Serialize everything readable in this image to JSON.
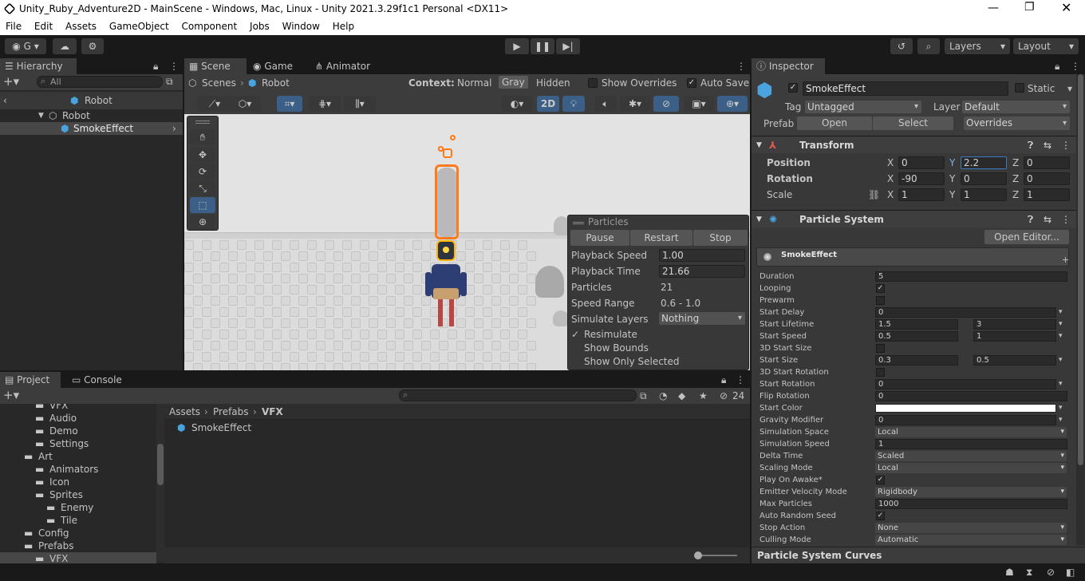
{
  "window": {
    "title": "Unity_Ruby_Adventure2D - MainScene - Windows, Mac, Linux - Unity 2021.3.29f1c1 Personal <DX11>"
  },
  "menu": [
    "File",
    "Edit",
    "Assets",
    "GameObject",
    "Component",
    "Jobs",
    "Window",
    "Help"
  ],
  "toolbar": {
    "account_label": "G",
    "layers_label": "Layers",
    "layout_label": "Layout"
  },
  "hierarchy": {
    "tab": "Hierarchy",
    "search_placeholder": "All",
    "root": "Robot",
    "items": [
      "Robot",
      "SmokeEffect"
    ]
  },
  "scene": {
    "tabs": [
      "Scene",
      "Game",
      "Animator"
    ],
    "breadcrumb": [
      "Scenes",
      "Robot"
    ],
    "context_label": "Context:",
    "context_options": [
      "Normal",
      "Gray",
      "Hidden"
    ],
    "context_selected": "Gray",
    "show_overrides": "Show Overrides",
    "auto_save": "Auto Save",
    "btn_2d": "2D"
  },
  "particles_overlay": {
    "title": "Particles",
    "buttons": [
      "Pause",
      "Restart",
      "Stop"
    ],
    "rows": [
      {
        "label": "Playback Speed",
        "value": "1.00"
      },
      {
        "label": "Playback Time",
        "value": "21.66"
      },
      {
        "label": "Particles",
        "value": "21"
      },
      {
        "label": "Speed Range",
        "value": "0.6 - 1.0"
      }
    ],
    "simulate_layers_label": "Simulate Layers",
    "simulate_layers_value": "Nothing",
    "checks": [
      {
        "label": "Resimulate",
        "checked": true
      },
      {
        "label": "Show Bounds",
        "checked": false
      },
      {
        "label": "Show Only Selected",
        "checked": false
      }
    ]
  },
  "project": {
    "tabs": [
      "Project",
      "Console"
    ],
    "hidden_count": "24",
    "tree": [
      {
        "label": "VFX",
        "indent": 2
      },
      {
        "label": "Audio",
        "indent": 2
      },
      {
        "label": "Demo",
        "indent": 2
      },
      {
        "label": "Settings",
        "indent": 2
      },
      {
        "label": "Art",
        "indent": 1
      },
      {
        "label": "Animators",
        "indent": 2
      },
      {
        "label": "Icon",
        "indent": 2
      },
      {
        "label": "Sprites",
        "indent": 2
      },
      {
        "label": "Enemy",
        "indent": 3
      },
      {
        "label": "Tile",
        "indent": 3
      },
      {
        "label": "Config",
        "indent": 1
      },
      {
        "label": "Prefabs",
        "indent": 1
      },
      {
        "label": "VFX",
        "indent": 2
      }
    ],
    "breadcrumb": [
      "Assets",
      "Prefabs",
      "VFX"
    ],
    "asset": "SmokeEffect"
  },
  "inspector": {
    "tab": "Inspector",
    "object_name": "SmokeEffect",
    "static_label": "Static",
    "tag_label": "Tag",
    "tag_value": "Untagged",
    "layer_label": "Layer",
    "layer_value": "Default",
    "prefab_label": "Prefab",
    "prefab_open": "Open",
    "prefab_select": "Select",
    "prefab_overrides": "Overrides",
    "transform": {
      "title": "Transform",
      "position_label": "Position",
      "position": {
        "x": "0",
        "y": "2.2",
        "z": "0"
      },
      "rotation_label": "Rotation",
      "rotation": {
        "x": "-90",
        "y": "0",
        "z": "0"
      },
      "scale_label": "Scale",
      "scale": {
        "x": "1",
        "y": "1",
        "z": "1"
      }
    },
    "particle_system": {
      "title": "Particle System",
      "open_editor": "Open Editor...",
      "module_name": "SmokeEffect",
      "rows": [
        {
          "label": "Duration",
          "kind": "field",
          "value": "5"
        },
        {
          "label": "Looping",
          "kind": "check",
          "checked": true
        },
        {
          "label": "Prewarm",
          "kind": "check",
          "checked": false
        },
        {
          "label": "Start Delay",
          "kind": "field",
          "value": "0",
          "caret": true
        },
        {
          "label": "Start Lifetime",
          "kind": "pair",
          "value": "1.5",
          "value2": "3",
          "caret": true
        },
        {
          "label": "Start Speed",
          "kind": "pair",
          "value": "0.5",
          "value2": "1",
          "caret": true
        },
        {
          "label": "3D Start Size",
          "kind": "check",
          "checked": false
        },
        {
          "label": "Start Size",
          "kind": "pair",
          "value": "0.3",
          "value2": "0.5",
          "caret": true
        },
        {
          "label": "3D Start Rotation",
          "kind": "check",
          "checked": false
        },
        {
          "label": "Start Rotation",
          "kind": "field",
          "value": "0",
          "caret": true
        },
        {
          "label": "Flip Rotation",
          "kind": "field",
          "value": "0"
        },
        {
          "label": "Start Color",
          "kind": "color",
          "value": "#ffffff",
          "caret": true
        },
        {
          "label": "Gravity Modifier",
          "kind": "field",
          "value": "0",
          "caret": true
        },
        {
          "label": "Simulation Space",
          "kind": "dropdown",
          "value": "Local"
        },
        {
          "label": "Simulation Speed",
          "kind": "field",
          "value": "1"
        },
        {
          "label": "Delta Time",
          "kind": "dropdown",
          "value": "Scaled"
        },
        {
          "label": "Scaling Mode",
          "kind": "dropdown",
          "value": "Local"
        },
        {
          "label": "Play On Awake*",
          "kind": "check",
          "checked": true
        },
        {
          "label": "Emitter Velocity Mode",
          "kind": "dropdown",
          "value": "Rigidbody"
        },
        {
          "label": "Max Particles",
          "kind": "field",
          "value": "1000"
        },
        {
          "label": "Auto Random Seed",
          "kind": "check",
          "checked": true
        },
        {
          "label": "Stop Action",
          "kind": "dropdown",
          "value": "None"
        },
        {
          "label": "Culling Mode",
          "kind": "dropdown",
          "value": "Automatic"
        }
      ],
      "curves_label": "Particle System Curves"
    }
  },
  "colors": {
    "selection": "#2c5d87",
    "accent_orange": "#ff7a1a",
    "accent_blue": "#3b79c4"
  }
}
